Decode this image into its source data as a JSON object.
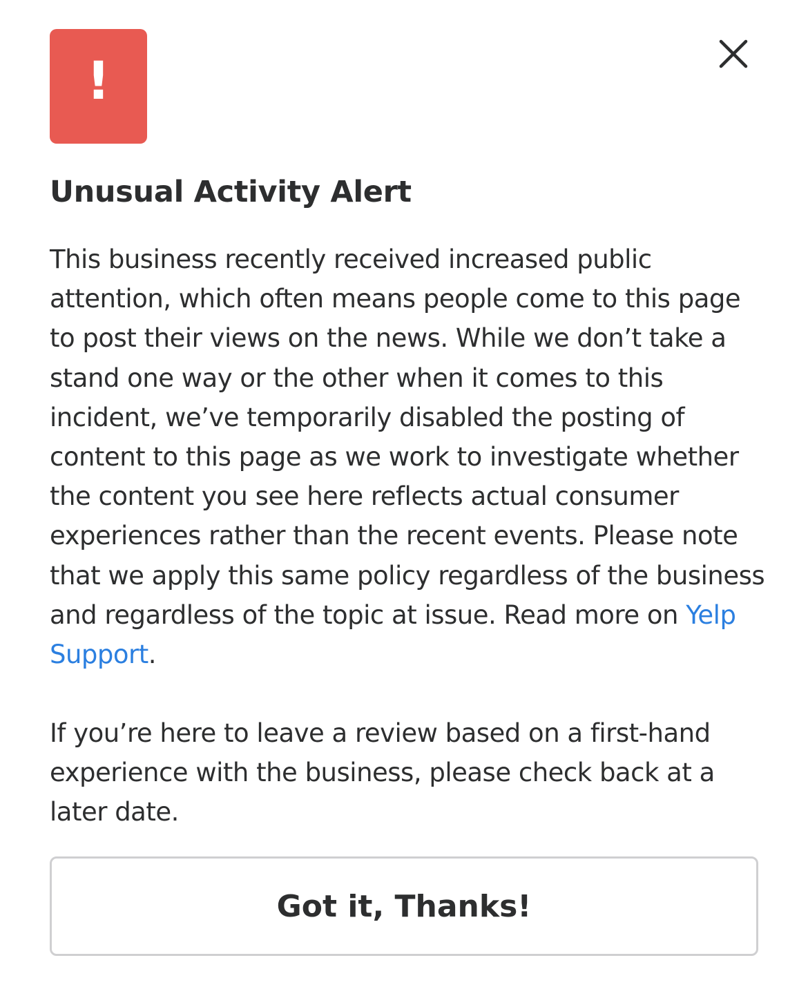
{
  "dialog": {
    "title": "Unusual Activity Alert",
    "alert_glyph": "!",
    "alert_color": "#e85a52",
    "close_icon": "close-icon",
    "paragraph1_text": "This business recently received increased public attention, which often means people come to this page to post their views on the news. While we don’t take a stand one way or the other when it comes to this incident, we’ve temporarily disabled the posting of content to this page as we work to investigate whether the content you see here reflects actual consumer experiences rather than the recent events. Please note that we apply this same policy regardless of the business and regardless of the topic at issue. Read more on ",
    "support_link_label": "Yelp Support",
    "link_color": "#2b7fe0",
    "paragraph1_end": ".",
    "paragraph2_text": "If you’re here to leave a review based on a first-hand experience with the business, please check back at a later date.",
    "button_label": "Got it, Thanks!"
  }
}
